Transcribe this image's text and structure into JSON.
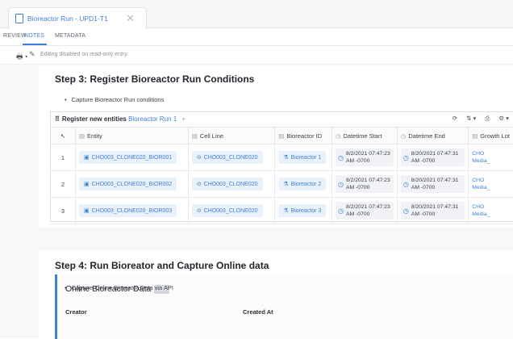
{
  "tab": {
    "title": "Bioreactor Run - UPD1-T1",
    "close": "✕"
  },
  "subnav": {
    "items": [
      "REVIEW",
      "NOTES",
      "METADATA"
    ]
  },
  "info": {
    "print_icon": "🖶 ▾",
    "message": "Editing disabled on read-only entry."
  },
  "step3": {
    "title": "Step 3: Register Bioreactor Run Conditions",
    "bullet": "Capture Bioreactor Run conditions",
    "register_label": "Register new entities",
    "entity_name": "Bioreactor Run 1",
    "columns": [
      "Entity",
      "Cell Line",
      "Bioreactor ID",
      "Datetime Start",
      "Datetime End",
      "Growth Lot"
    ],
    "rows": [
      {
        "num": "1",
        "entity": "CHO003_CLONE020_BIOR001",
        "cell_line": "CHO003_CLONE020",
        "bioreactor": "Bioreactor 1",
        "start": [
          "8/2/2021 07:47:23",
          "AM -0700"
        ],
        "end": [
          "8/20/2021 07:47:31",
          "AM -0700"
        ],
        "lot": [
          "CHO",
          "Media_"
        ]
      },
      {
        "num": "2",
        "entity": "CHO003_CLONE020_BIOR002",
        "cell_line": "CHO003_CLONE020",
        "bioreactor": "Bioreactor 2",
        "start": [
          "8/2/2021 07:47:23",
          "AM -0700"
        ],
        "end": [
          "8/20/2021 07:47:31",
          "AM -0700"
        ],
        "lot": [
          "CHO",
          "Media_"
        ]
      },
      {
        "num": "3",
        "entity": "CHO003_CLONE020_BIOR003",
        "cell_line": "CHO003_CLONE020",
        "bioreactor": "Bioreactor 3",
        "start": [
          "8/2/2021 07:47:23",
          "AM -0700"
        ],
        "end": [
          "8/20/2021 07:47:31",
          "AM -0700"
        ],
        "lot": [
          "CHO",
          "Media_"
        ]
      }
    ]
  },
  "step4": {
    "title": "Step 4: Run Bioreator and Capture Online data",
    "bullet": "Capture Online Bioreator Data via API",
    "online_title": "Online Bioreactor Data",
    "badge": "API",
    "creator_label": "Creator",
    "created_at_label": "Created At"
  },
  "colors": {
    "accent": "#3f7fd8",
    "chip_bg": "#e9f1fb"
  }
}
